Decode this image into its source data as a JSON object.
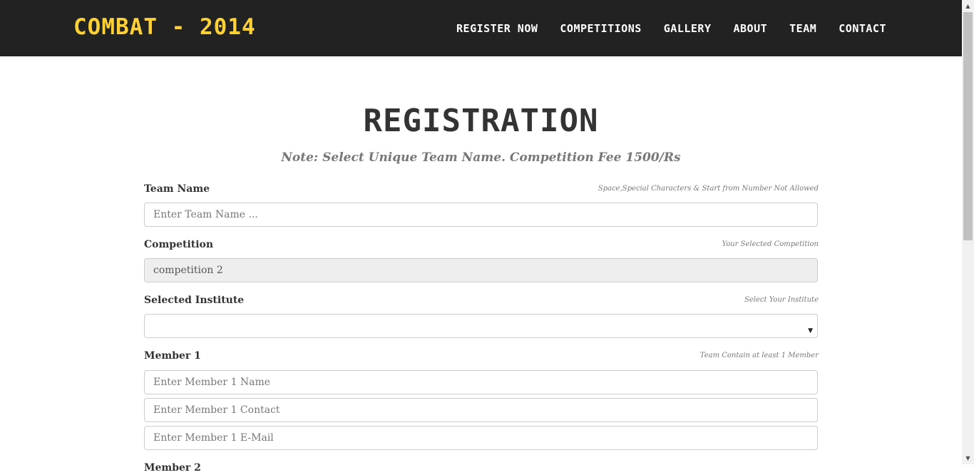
{
  "navbar": {
    "brand": "COMBAT - 2014",
    "items": [
      "REGISTER NOW",
      "COMPETITIONS",
      "GALLERY",
      "ABOUT",
      "TEAM",
      "CONTACT"
    ]
  },
  "page": {
    "heading": "REGISTRATION",
    "note": "Note: Select Unique Team Name. Competition Fee 1500/Rs"
  },
  "form": {
    "team_name": {
      "label": "Team Name",
      "hint": "Space,Special Characters & Start from Number Not Allowed",
      "placeholder": "Enter Team Name ..."
    },
    "competition": {
      "label": "Competition",
      "hint": "Your Selected Competition",
      "value": "competition 2"
    },
    "institute": {
      "label": "Selected Institute",
      "hint": "Select Your Institute",
      "value": ""
    },
    "member1": {
      "label": "Member 1",
      "hint": "Team Contain at least 1 Member",
      "name_placeholder": "Enter Member 1 Name",
      "contact_placeholder": "Enter Member 1 Contact",
      "email_placeholder": "Enter Member 1 E-Mail"
    },
    "member2": {
      "label": "Member 2"
    }
  },
  "icons": {
    "select_arrow": "caret-down-icon",
    "scroll_up": "scroll-up-arrow-icon",
    "scroll_down": "scroll-down-arrow-icon"
  },
  "colors": {
    "navbar_bg": "#222222",
    "brand": "#fed136",
    "nav_text": "#ffffff",
    "readonly_bg": "#eeeeee"
  }
}
